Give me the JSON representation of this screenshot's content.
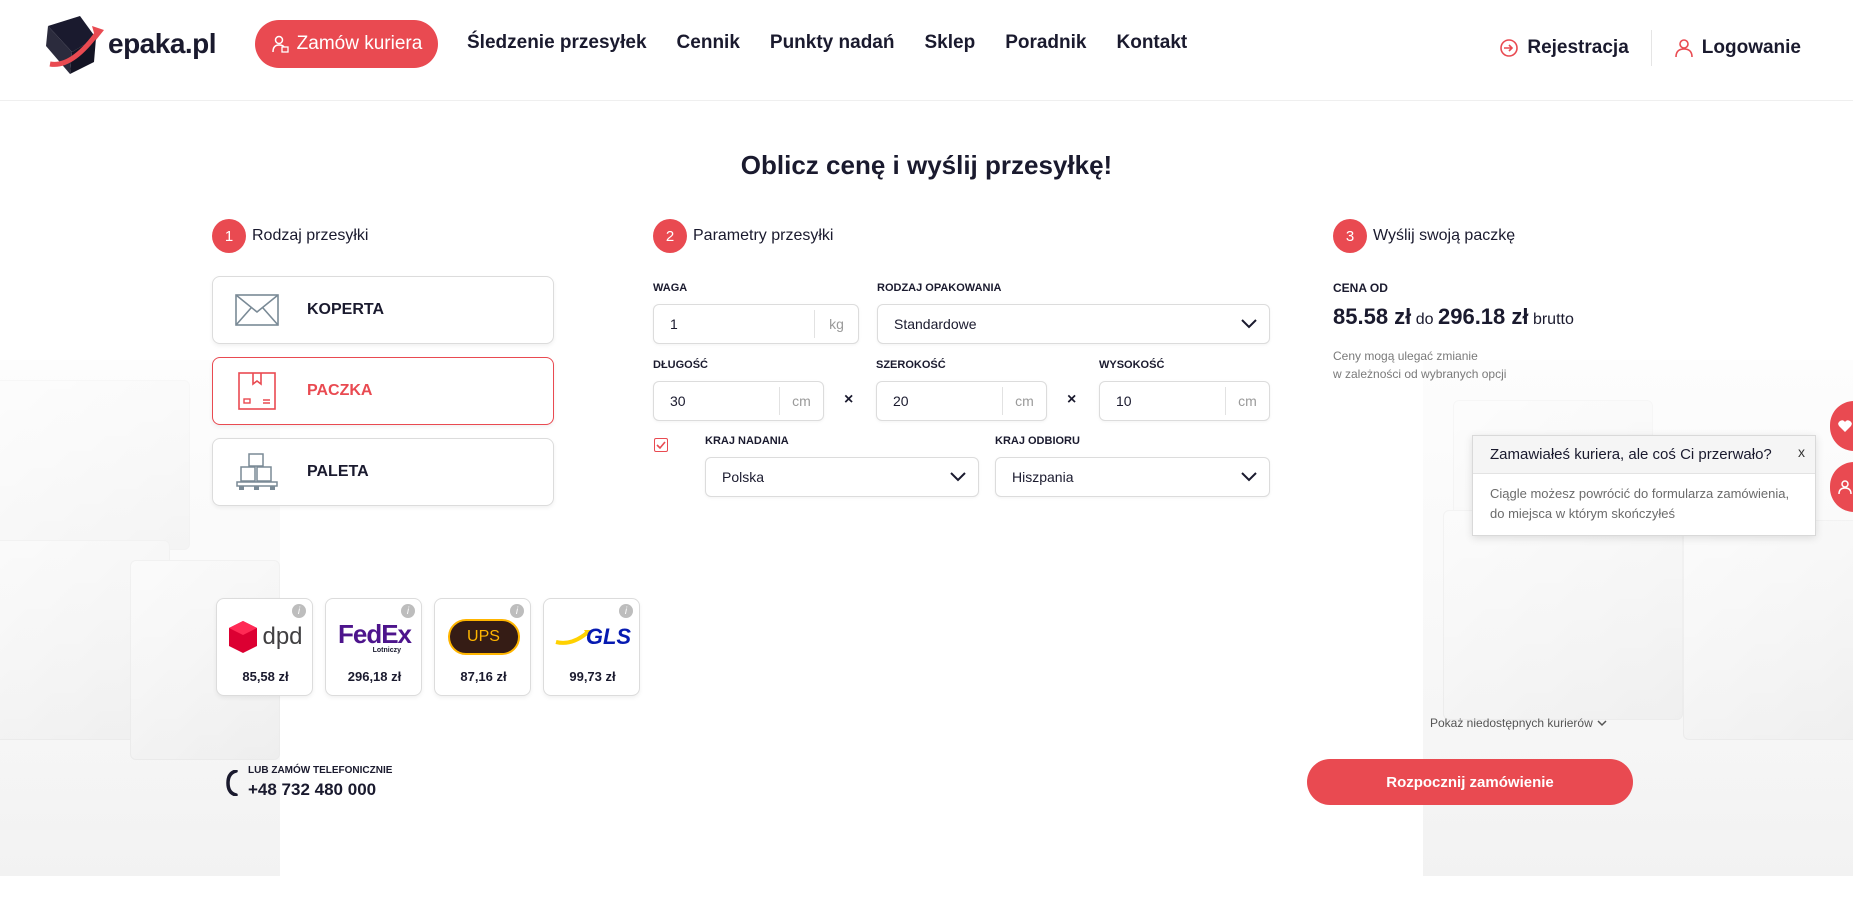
{
  "brand": {
    "name": "epaka.pl",
    "accent": "#e94a51"
  },
  "header": {
    "order_courier": "Zamów kuriera",
    "nav": [
      "Śledzenie przesyłek",
      "Cennik",
      "Punkty nadań",
      "Sklep",
      "Poradnik",
      "Kontakt"
    ],
    "register": "Rejestracja",
    "login": "Logowanie"
  },
  "page_title": "Oblicz cenę i wyślij przesyłkę!",
  "steps": {
    "s1": {
      "num": "1",
      "label": "Rodzaj przesyłki"
    },
    "s2": {
      "num": "2",
      "label": "Parametry przesyłki"
    },
    "s3": {
      "num": "3",
      "label": "Wyślij swoją paczkę"
    }
  },
  "types": [
    {
      "label": "KOPERTA",
      "icon": "envelope-icon"
    },
    {
      "label": "PACZKA",
      "icon": "package-icon",
      "active": true
    },
    {
      "label": "PALETA",
      "icon": "pallet-icon"
    }
  ],
  "params": {
    "weight": {
      "label": "WAGA",
      "value": "1",
      "unit": "kg"
    },
    "packaging": {
      "label": "RODZAJ OPAKOWANIA",
      "value": "Standardowe"
    },
    "length": {
      "label": "DŁUGOŚĆ",
      "value": "30",
      "unit": "cm"
    },
    "width": {
      "label": "SZEROKOŚĆ",
      "value": "20",
      "unit": "cm"
    },
    "height": {
      "label": "WYSOKOŚĆ",
      "value": "10",
      "unit": "cm"
    },
    "times": "×",
    "country_from": {
      "label": "KRAJ NADANIA",
      "value": "Polska"
    },
    "country_to": {
      "label": "KRAJ ODBIORU",
      "value": "Hiszpania"
    }
  },
  "price": {
    "label": "CENA OD",
    "min": "85.58 zł",
    "to": "do",
    "max": "296.18 zł",
    "suffix": "brutto",
    "note_line1": "Ceny mogą ulegać zmianie",
    "note_line2": "w zależności od wybranych opcji"
  },
  "popup": {
    "title": "Zamawiałeś kuriera, ale coś Ci przerwało?",
    "close": "x",
    "body": "Ciągle możesz powrócić do formularza zamówienia, do miejsca w którym skończyłeś"
  },
  "couriers": [
    {
      "name": "dpd",
      "price": "85,58 zł"
    },
    {
      "name": "FedEx",
      "sub": "Lotniczy",
      "price": "296,18 zł"
    },
    {
      "name": "UPS",
      "price": "87,16 zł"
    },
    {
      "name": "GLS",
      "price": "99,73 zł"
    }
  ],
  "info_glyph": "i",
  "show_unavailable": "Pokaż niedostępnych kurierów",
  "phone": {
    "label": "LUB ZAMÓW TELEFONICZNIE",
    "number": "+48 732 480 000"
  },
  "start_order": "Rozpocznij zamówienie"
}
